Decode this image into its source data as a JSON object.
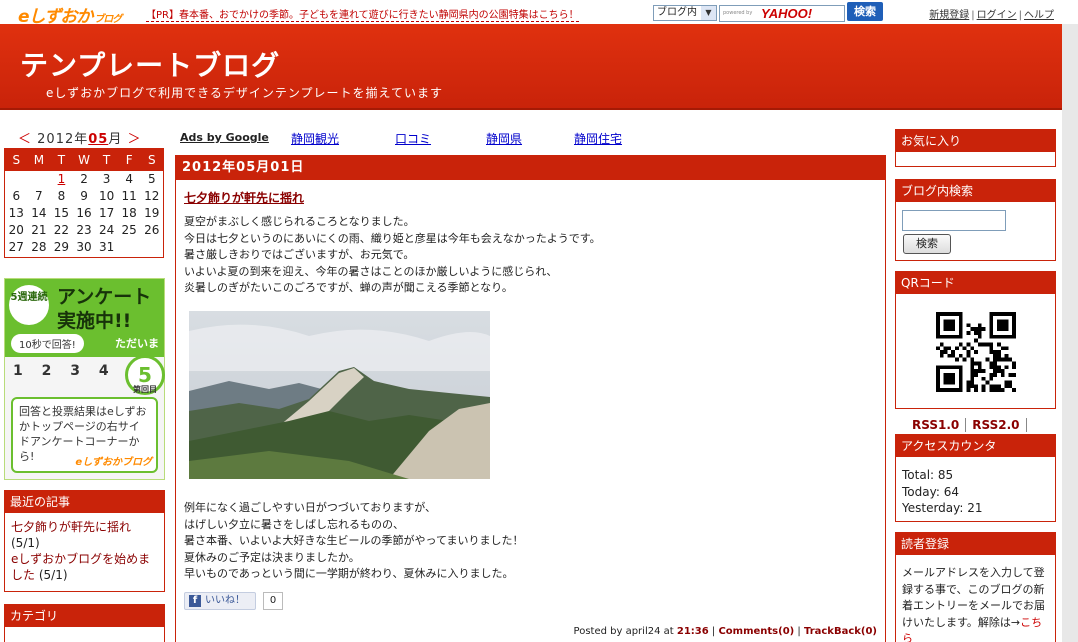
{
  "topbar": {
    "logo": "eしずおか",
    "logo_sub": "ブログ",
    "pr_text": "【PR】春本番、おでかけの季節。子どもを連れて遊びに行きたい静岡県内の公園特集はこちら！",
    "search_scope": "ブログ内",
    "search_powered": "powered by",
    "search_brand": "YAHOO!",
    "search_button": "検索",
    "links": [
      "新規登録",
      "ログイン",
      "ヘルプ"
    ]
  },
  "header": {
    "title": "テンプレートブログ",
    "description": "eしずおかブログで利用できるデザインテンプレートを揃えています"
  },
  "calendar": {
    "prev": "＜",
    "year": "2012年",
    "month": "05",
    "month_suffix": "月",
    "next": "＞",
    "weekdays": [
      "S",
      "M",
      "T",
      "W",
      "T",
      "F",
      "S"
    ],
    "weeks": [
      [
        "",
        "",
        "1",
        "2",
        "3",
        "4",
        "5"
      ],
      [
        "6",
        "7",
        "8",
        "9",
        "10",
        "11",
        "12"
      ],
      [
        "13",
        "14",
        "15",
        "16",
        "17",
        "18",
        "19"
      ],
      [
        "20",
        "21",
        "22",
        "23",
        "24",
        "25",
        "26"
      ],
      [
        "27",
        "28",
        "29",
        "30",
        "31",
        "",
        ""
      ]
    ],
    "linked_day": "1"
  },
  "survey_ad": {
    "badge": "5週連続",
    "headline_1": "アンケート",
    "headline_2": "実施中!!",
    "pill": "10秒で回答!",
    "now": "ただいま",
    "numbers": "1 2 3 4",
    "round_prefix": "第",
    "round_number": "5",
    "round_suffix": "回目",
    "body": "回答と投票結果はeしずおかトップページの右サイドアンケートコーナーから!",
    "logo": "eしずおかブログ"
  },
  "recent": {
    "title": "最近の記事",
    "items": [
      {
        "title": "七夕飾りが軒先に揺れ",
        "date": "(5/1)"
      },
      {
        "title": "eしずおかブログを始めました",
        "date": "(5/1)"
      }
    ]
  },
  "category": {
    "title": "カテゴリ"
  },
  "ad_links": {
    "label": "Ads by Google",
    "items": [
      "静岡観光",
      "口コミ",
      "静岡県",
      "静岡住宅"
    ]
  },
  "post": {
    "date": "2012年05月01日",
    "title": "七夕飾りが軒先に揺れ",
    "para1": [
      "夏空がまぶしく感じられるころとなりました。",
      "今日は七夕というのにあいにくの雨、織り姫と彦星は今年も会えなかったようです。",
      "暑さ厳しきおりではございますが、お元気で。",
      "いよいよ夏の到来を迎え、今年の暑さはことのほか厳しいように感じられ、",
      "炎暑しのぎがたいこのごろですが、蝉の声が聞こえる季節となり。"
    ],
    "para2": [
      "例年になく過ごしやすい日がつづいておりますが、",
      "はげしい夕立に暑さをしばし忘れるものの、",
      "暑さ本番、いよいよ大好きな生ビールの季節がやってまいりました！",
      "夏休みのご予定は決まりましたか。",
      "早いものであっという間に一学期が終わり、夏休みに入りました。"
    ],
    "like_label": "いいね！",
    "like_count": "0",
    "footer_prefix": "Posted by april24 at",
    "time": "21:36",
    "comments": "Comments(0)",
    "trackback": "TrackBack(0)"
  },
  "sidebar_right": {
    "favorites": "お気に入り",
    "blog_search": "ブログ内検索",
    "search_button": "検索",
    "qr": "QRコード",
    "rss1": "RSS1.0",
    "rss2": "RSS2.0",
    "access_title": "アクセスカウンタ",
    "total": "Total: 85",
    "today": "Today: 64",
    "yesterday": "Yesterday: 21",
    "reader_title": "読者登録",
    "reader_body": "メールアドレスを入力して登録する事で、このブログの新着エントリーをメールでお届けいたします。解除は→",
    "reader_link": "こちら"
  },
  "colors": {
    "header_red": "#c9230a",
    "link_red": "#8a0000",
    "survey_green": "#6bbf2f",
    "yahoo_blue": "#1f5fb8"
  }
}
